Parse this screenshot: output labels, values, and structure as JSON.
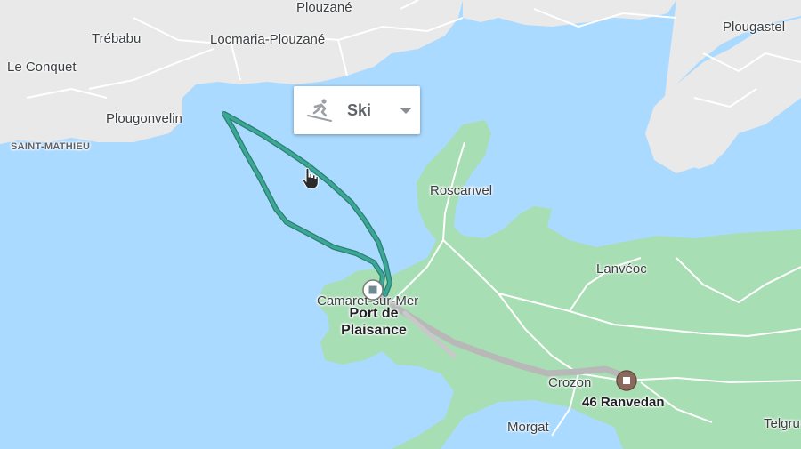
{
  "map": {
    "places": {
      "plouzane": "Plouzané",
      "trebabu": "Trébabu",
      "locmaria": "Locmaria-Plouzané",
      "le_conquet": "Le Conquet",
      "plougonvelin": "Plougonvelin",
      "saint_mathieu": "SAINT-MATHIEU",
      "plougastel": "Plougastel",
      "roscanvel": "Roscanvel",
      "lanveoc": "Lanvéoc",
      "camaret": "Camaret-sur-Mer",
      "crozon": "Crozon",
      "morgat": "Morgat",
      "telgruc": "Telgru"
    },
    "markers": {
      "start_name": "Port de Plaisance",
      "end_name": "46 Ranvedan"
    },
    "route": {
      "color": "#3aa896",
      "alt_color": "#b8b8b8"
    },
    "colors": {
      "water": "#aadaff",
      "land_north": "#e8e8e8",
      "land_south": "#a8deb3"
    }
  },
  "mode_popup": {
    "mode": "Ski",
    "icon": "skiing-icon"
  }
}
